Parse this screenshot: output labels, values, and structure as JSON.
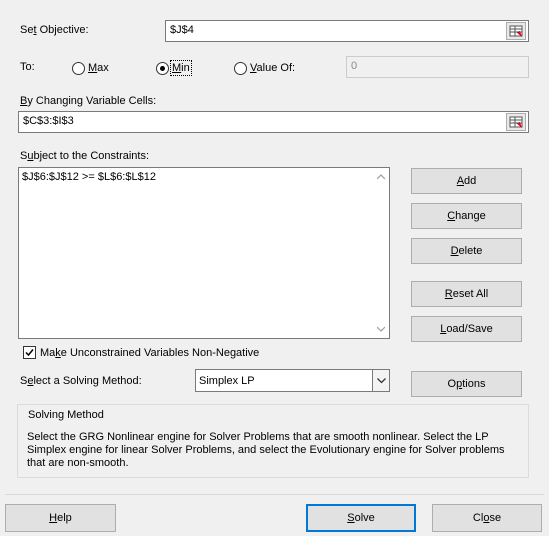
{
  "objective": {
    "label_u": "t",
    "label_pre": "Se",
    "label_post": " Objective:",
    "value": "$J$4"
  },
  "to": {
    "label": "To:",
    "max": {
      "u": "M",
      "rest": "ax",
      "selected": false
    },
    "min": {
      "u": "M",
      "rest": "in",
      "selected": true
    },
    "value_of": {
      "u": "V",
      "rest": "alue Of:",
      "selected": false,
      "value": "0"
    }
  },
  "changing": {
    "label_u": "B",
    "label_post": "y Changing Variable Cells:",
    "value": "$C$3:$I$3"
  },
  "constraints": {
    "label_u": "u",
    "label_pre": "S",
    "label_post": "bject to the Constraints:",
    "items": [
      "$J$6:$J$12 >= $L$6:$L$12"
    ]
  },
  "buttons": {
    "add": {
      "u": "A",
      "rest": "dd"
    },
    "change": {
      "u": "C",
      "rest": "hange"
    },
    "delete": {
      "u": "D",
      "rest": "elete"
    },
    "reset_all": {
      "u": "R",
      "rest": "eset All"
    },
    "load_save": {
      "u": "L",
      "rest": "oad/Save"
    },
    "options": {
      "u": "p",
      "pre": "O",
      "rest": "tions"
    }
  },
  "nonneg": {
    "checked": true,
    "u": "k",
    "pre": "Ma",
    "rest": "e Unconstrained Variables Non-Negative"
  },
  "method": {
    "label_pre": "S",
    "label_u": "e",
    "label_post": "lect a Solving Method:",
    "value": "Simplex LP"
  },
  "solving_method": {
    "title": "Solving Method",
    "text": "Select the GRG Nonlinear engine for Solver Problems that are smooth nonlinear. Select the LP Simplex engine for linear Solver Problems, and select the Evolutionary engine for Solver problems that are non-smooth."
  },
  "footer": {
    "help": {
      "u": "H",
      "rest": "elp"
    },
    "solve": {
      "u": "S",
      "rest": "olve"
    },
    "close": {
      "pre": "Cl",
      "u": "o",
      "rest": "se"
    }
  }
}
